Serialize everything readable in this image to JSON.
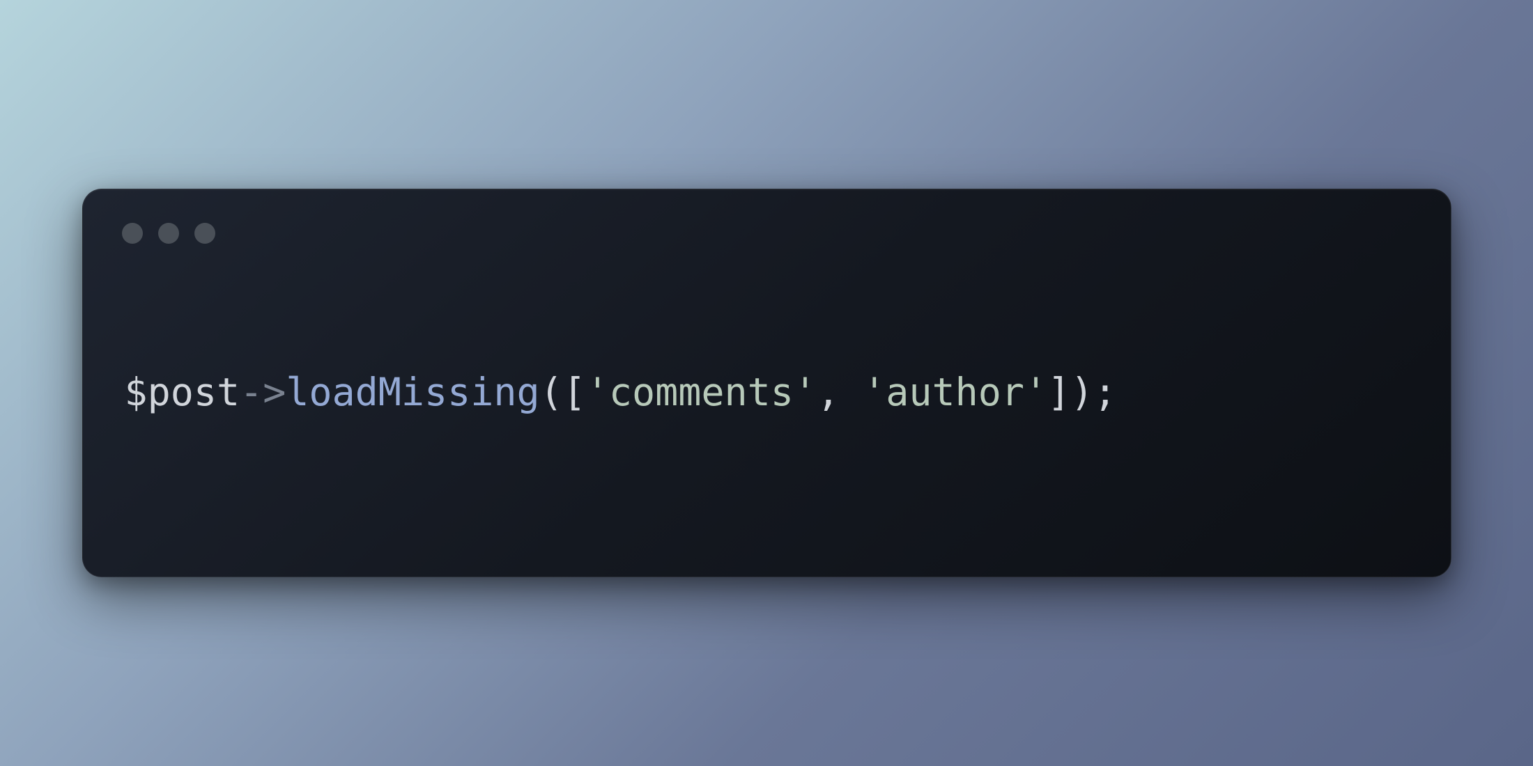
{
  "code": {
    "variable": "$post",
    "arrow": "->",
    "method": "loadMissing",
    "openParen": "(",
    "openBracket": "[",
    "string1": "'comments'",
    "comma": ", ",
    "string2": "'author'",
    "closeBracket": "]",
    "closeParen": ")",
    "semicolon": ";"
  },
  "colors": {
    "variable": "#d1d5db",
    "arrow": "#7a8290",
    "method": "#94a9d4",
    "string": "#b7c9b9",
    "bracket": "#d1d5db",
    "windowBg": "#141820",
    "trafficLight": "#4a5058"
  }
}
